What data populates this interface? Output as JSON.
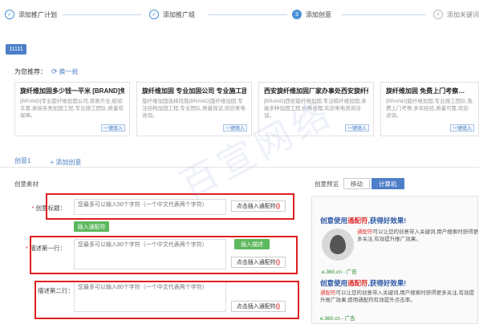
{
  "steps": [
    {
      "num": "✓",
      "label": "添加推广计划",
      "state": "done"
    },
    {
      "num": "✓",
      "label": "添加推广组",
      "state": "done"
    },
    {
      "num": "3",
      "label": "添加创意",
      "state": "current"
    },
    {
      "num": "4",
      "label": "添加关键词",
      "state": "future"
    }
  ],
  "id_badge": "11111",
  "recommend": {
    "label": "为您推荐：",
    "refresh": "换一批"
  },
  "cards": [
    {
      "title": "旋纤维加固多少钱一平米 [BRAND]免...",
      "desc": "[BRAND]专业旋纤维加固公司,资质齐全,经验丰富,承接各类加固工程,专业施工团队,质量有保障。",
      "use": "一键填入"
    },
    {
      "title": "旋纤维加固 专业加固公司 专业施工团队",
      "desc": "旋纤维加固选择找我[BRAND]旋纤维加固,专注结构加固工程,专业团队,质量保证,欢迎来电咨询。",
      "use": "一键填入"
    },
    {
      "title": "西安旋纤维加固厂家办事处西安旋纤维...",
      "desc": "[BRAND]西安旋纤维加固,专注碳纤维加固,承接多种加固工程,价格合理,欢迎来电咨询洽谈。",
      "use": "一键填入"
    },
    {
      "title": "旋纤维加固 免费上门考察…",
      "desc": "[BRAND]旋纤维加固,专业施工团队,免费上门考察,多年经验,质量可靠,欢迎咨询。",
      "use": "一键填入"
    }
  ],
  "creative_tabs": {
    "current": "创意1",
    "add": "+ 添加创意"
  },
  "form": {
    "section_title": "创意素材",
    "title_label": "创意标题",
    "title_placeholder": "您最多可以输入50个字符（一个中文代表两个字符）",
    "title_wild": {
      "text": "点击插入通配符",
      "wild": "{}"
    },
    "title_green_button": "插入通配符",
    "desc1_label": "描述第一行",
    "desc1_placeholder": "您最多可以输入80个字符（一个中文代表两个字符）",
    "desc1_green_button": "插入描述",
    "desc1_wild": {
      "text": "点击插入通配符",
      "wild": "{}"
    },
    "desc2_label": "描述第二行",
    "desc2_placeholder": "您最多可以输入80个字符（一个中文代表两个字符）",
    "desc2_wild": {
      "text": "点击插入通配符",
      "wild": "{}"
    }
  },
  "preview": {
    "label": "创意预览",
    "tabs": [
      {
        "label": "移动",
        "active": false
      },
      {
        "label": "计算机",
        "active": true
      }
    ],
    "ad1": {
      "title_pre": "创意使用",
      "title_em": "通配符",
      "title_post": ",获得好效果!",
      "desc_em": "通配符",
      "desc_text": "可以让您的创意带入关键词,用户搜索时获得更多关注,有效提升推广效果。",
      "url": "e.360.cn - 广告"
    },
    "ad2": {
      "title_pre": "创意使用",
      "title_em": "通配符",
      "title_post": ",获得好效果!",
      "desc_em": "通配符",
      "desc_text": "可以让您的创意带入关键词,用户搜索时获得更多关注,有效提升推广效果,使用通配符有效提升点击率。",
      "url": "e.360.cn - 广告"
    }
  },
  "watermark": "百宣网络"
}
